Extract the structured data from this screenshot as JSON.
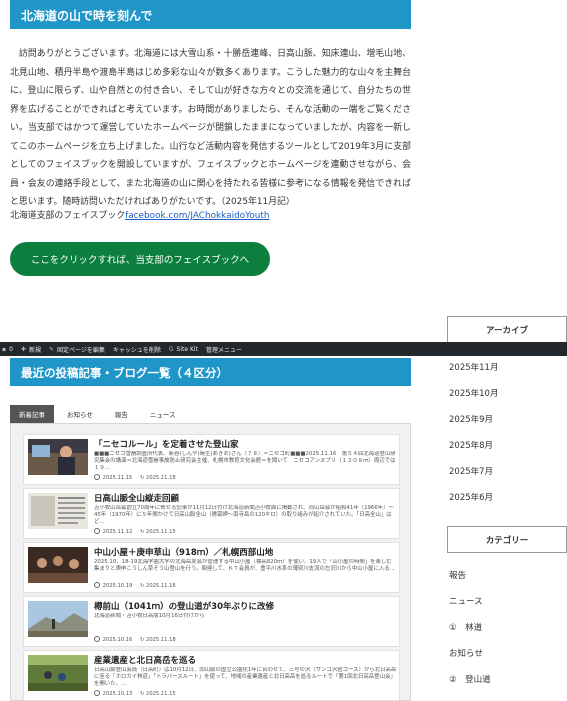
{
  "hero": {
    "title": "北海道の山で時を刻んで"
  },
  "intro": {
    "paragraph": "　訪問ありがとうございます。北海道には大雪山系・十勝岳連峰、日高山脈、知床連山、増毛山地、北見山地、積丹半島や渡島半島はじめ多彩な山々が数多くあります。こうした魅力的な山々を主舞台に、登山に限らず、山や自然との付き合い、そして山が好きな方々との交流を通じて、自分たちの世界を広げることができればと考えています。お時間がありましたら、そんな活動の一端をご覧ください。当支部ではかつて運営していたホームページが閉鎖したままになっていましたが、内容を一新してこのホームページを立ち上げました。山行など活動内容を発信するツールとして2019年3月に支部としてのフェイスブックを開設していますが、フェイスブックとホームページを連動させながら、会員・会友の連絡手段として、また北海道の山に関心を持たれる皆様に参考になる情報を発信できればと思います。随時訪問いただければありがたいです。（2025年11月記）",
    "fb_prefix": "北海道支部のフェイスブック",
    "fb_link": "facebook.com/JAChokkaidoYouth",
    "fb_button": "ここをクリックすれば、当支部のフェイスブックへ"
  },
  "admin_bar": {
    "comments_count": "0",
    "new_label": "新規",
    "edit_label": "固定ページを編集",
    "cache_label": "キャッシュを削除",
    "sitekit_label": "Site Kit",
    "menu_label": "管理メニュー"
  },
  "sidebar": {
    "archive_title": "アーカイブ",
    "archives": [
      "2025年11月",
      "2025年10月",
      "2025年9月",
      "2025年8月",
      "2025年7月",
      "2025年6月"
    ],
    "category_title": "カテゴリー",
    "categories": [
      "報告",
      "ニュース",
      "①　林道",
      "お知らせ",
      "②　登山道"
    ]
  },
  "posts": {
    "title": "最近の投稿記事・ブログ一覧（４区分）",
    "tabs": [
      "新着記事",
      "お知らせ",
      "報告",
      "ニュース"
    ],
    "active_tab": 0,
    "items": [
      {
        "title": "「ニセコルール」を定着させた登山家",
        "excerpt": "■■■ニセコ雪崩調査所代表、新谷(しんや)暁生(あきお)さん（７８）＝ニセコ町■■■2025.11.16　第５４回北海道登山研究集会の講演＝北海道雪崩事故防止研究会主催、札幌市教育文化会館＝を聞いて　ニセコアンヌプリ（１３０８ｍ）周辺では１９...",
        "date": "2025.11.15",
        "updated": "2025.11.18"
      },
      {
        "title": "日高山脈全山縦走回顧",
        "excerpt": "苫小牧山岳会創立70周年に寄せる記事が11月12日付け北海道新聞苫小牧面に掲載され、同山岳会が昭和41年（1966年）～45年（1970年）に５年間かけて日高山脈全山（襟裳岬～南寺岳の120キロ）の取り組みが紹介されていた。「日高全山」はど...",
        "date": "2025.11.12",
        "updated": "2025.11.15"
      },
      {
        "title": "中山小屋＋庚申草山（918ｍ）／札幌西部山地",
        "excerpt": "2025.10．18-19北海学園大学の北海岳友会が管理する中山小屋（標高820ｍ）を使い、19人で「山小屋の時間」を楽しむ集まりと庚申こうしん草そう山登山を行う。関連して、ＫＴ会員が、豊平川水系の薄別川支流の左沢川から中山小屋に入る...",
        "date": "2025.10.19",
        "updated": "2025.11.16"
      },
      {
        "title": "樽前山（1041ｍ）の登山道が30年ぶりに改修",
        "excerpt": "北海道新聞・苫小牧日高版10月16日付けから",
        "date": "2025.10.16",
        "updated": "2025.11.18"
      },
      {
        "title": "産業遺産と北日高岳を巡る",
        "excerpt": "日高山脈登山会員（日高町）は10月12日、同山脈の国立公園化1年に合わせて、三号の沢（サンゴ沢岩コース）から北日高岳に至る「ホロカイ林道」「トラバースルート」を使って、地域の産業遺産と北日高岳を巡るルートで「第1回北日高岳登山会」を開いた。...",
        "date": "2025.10.13",
        "updated": "2025.11.15"
      }
    ]
  }
}
